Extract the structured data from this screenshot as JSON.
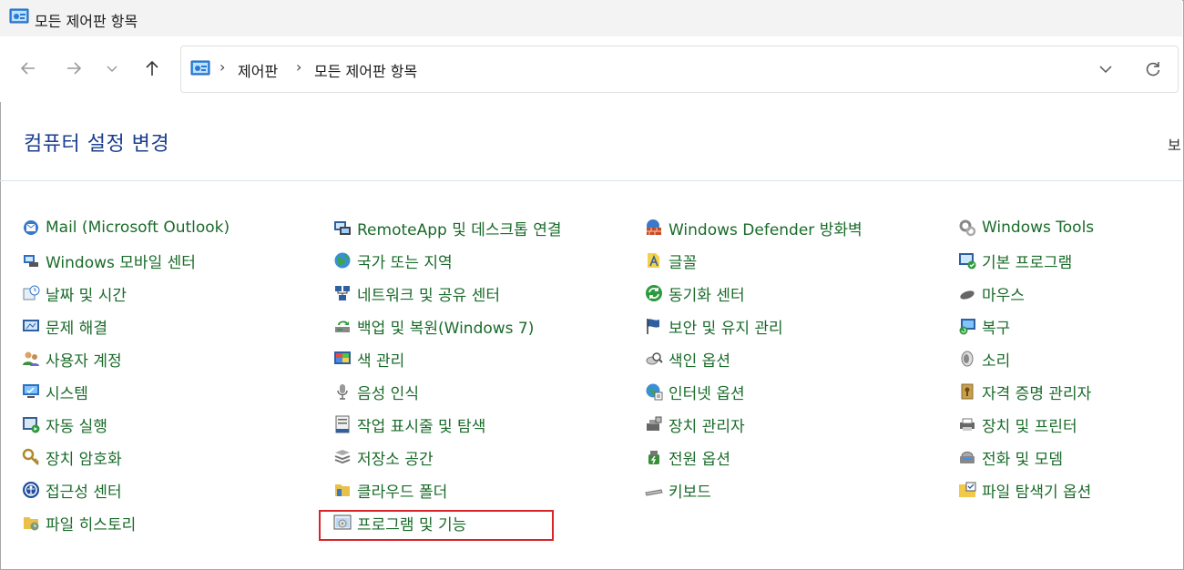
{
  "window": {
    "title": "모든 제어판 항목"
  },
  "address_bar": {
    "crumbs": [
      "제어판",
      "모든 제어판 항목"
    ],
    "separator": "›"
  },
  "page": {
    "heading": "컴퓨터 설정 변경",
    "view_label": "보"
  },
  "items": {
    "col1": [
      {
        "label": "Mail (Microsoft Outlook)",
        "icon": "mail-icon"
      },
      {
        "label": "Windows 모바일 센터",
        "icon": "mobility-center-icon"
      },
      {
        "label": "날짜 및 시간",
        "icon": "date-time-icon"
      },
      {
        "label": "문제 해결",
        "icon": "troubleshoot-icon"
      },
      {
        "label": "사용자 계정",
        "icon": "user-accounts-icon"
      },
      {
        "label": "시스템",
        "icon": "system-icon"
      },
      {
        "label": "자동 실행",
        "icon": "autoplay-icon"
      },
      {
        "label": "장치 암호화",
        "icon": "device-encryption-icon"
      },
      {
        "label": "접근성 센터",
        "icon": "ease-of-access-icon"
      },
      {
        "label": "파일 히스토리",
        "icon": "file-history-icon"
      }
    ],
    "col2": [
      {
        "label": "RemoteApp 및 데스크톱 연결",
        "icon": "remoteapp-icon"
      },
      {
        "label": "국가 또는 지역",
        "icon": "region-icon"
      },
      {
        "label": "네트워크 및 공유 센터",
        "icon": "network-icon"
      },
      {
        "label": "백업 및 복원(Windows 7)",
        "icon": "backup-icon"
      },
      {
        "label": "색 관리",
        "icon": "color-management-icon"
      },
      {
        "label": "음성 인식",
        "icon": "speech-icon"
      },
      {
        "label": "작업 표시줄 및 탐색",
        "icon": "taskbar-icon"
      },
      {
        "label": "저장소 공간",
        "icon": "storage-spaces-icon"
      },
      {
        "label": "클라우드 폴더",
        "icon": "cloud-folder-icon"
      },
      {
        "label": "프로그램 및 기능",
        "icon": "programs-features-icon"
      }
    ],
    "col3": [
      {
        "label": "Windows Defender 방화벽",
        "icon": "firewall-icon"
      },
      {
        "label": "글꼴",
        "icon": "fonts-icon"
      },
      {
        "label": "동기화 센터",
        "icon": "sync-center-icon"
      },
      {
        "label": "보안 및 유지 관리",
        "icon": "security-flag-icon"
      },
      {
        "label": "색인 옵션",
        "icon": "indexing-icon"
      },
      {
        "label": "인터넷 옵션",
        "icon": "internet-options-icon"
      },
      {
        "label": "장치 관리자",
        "icon": "device-manager-icon"
      },
      {
        "label": "전원 옵션",
        "icon": "power-options-icon"
      },
      {
        "label": "키보드",
        "icon": "keyboard-icon"
      }
    ],
    "col4": [
      {
        "label": "Windows Tools",
        "icon": "windows-tools-icon"
      },
      {
        "label": "기본 프로그램",
        "icon": "default-programs-icon"
      },
      {
        "label": "마우스",
        "icon": "mouse-icon"
      },
      {
        "label": "복구",
        "icon": "recovery-icon"
      },
      {
        "label": "소리",
        "icon": "sound-icon"
      },
      {
        "label": "자격 증명 관리자",
        "icon": "credential-manager-icon"
      },
      {
        "label": "장치 및 프린터",
        "icon": "devices-printers-icon"
      },
      {
        "label": "전화 및 모뎀",
        "icon": "phone-modem-icon"
      },
      {
        "label": "파일 탐색기 옵션",
        "icon": "explorer-options-icon"
      }
    ]
  },
  "colors": {
    "link_green": "#1a6b2a",
    "heading_blue": "#1b3f8f",
    "highlight_red": "#d9242a"
  }
}
